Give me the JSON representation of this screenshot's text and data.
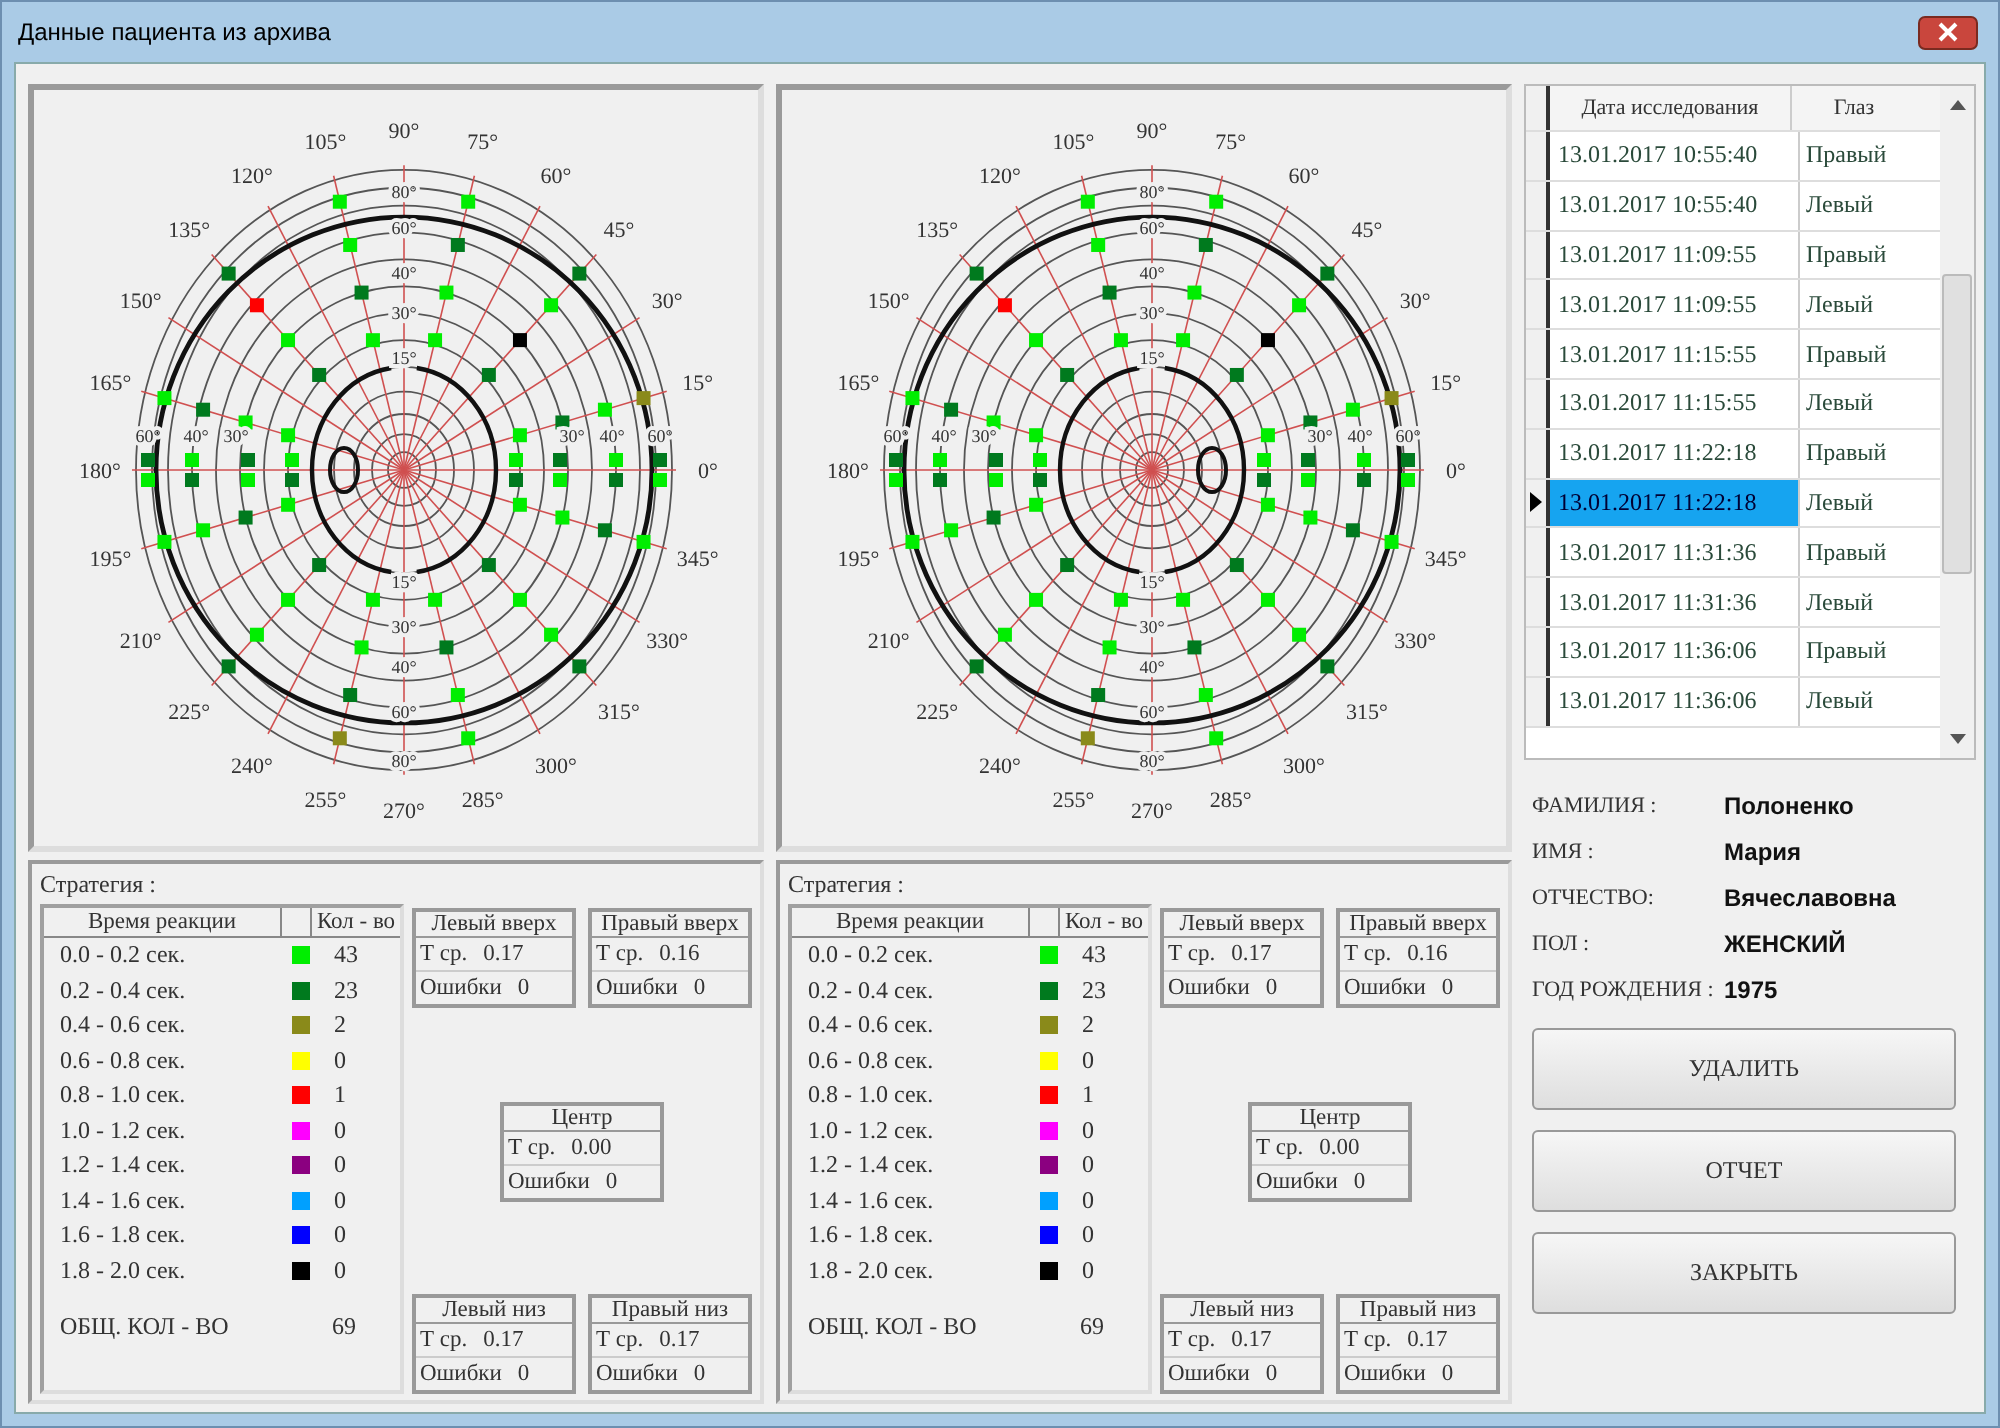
{
  "window": {
    "title": "Данные пациента из архива"
  },
  "fields": [
    {
      "plot": {
        "blind_spot_on_left": true,
        "angle_label_top": "90°",
        "angle_labels_left": [
          "105°",
          "120°",
          "135°",
          "150°",
          "165°",
          "180°",
          "195°",
          "210°",
          "225°",
          "240°",
          "255°"
        ],
        "angle_labels_right": [
          "75°",
          "60°",
          "45°",
          "30°",
          "15°",
          "0°",
          "345°",
          "330°",
          "315°",
          "300°",
          "285°"
        ],
        "angle_label_bottom": "270°",
        "ring_labels_top": [
          "80°",
          "60°",
          "40°",
          "30°",
          "15°"
        ],
        "ring_labels_bottom": [
          "15°",
          "30°",
          "40°",
          "60°",
          "80°"
        ],
        "ring_labels_left": [
          "60°",
          "40°",
          "30°"
        ],
        "ring_labels_right": [
          "30°",
          "40°",
          "60°"
        ]
      },
      "stats": {
        "strategy_label": "Стратегия :",
        "columns": [
          "Время реакции",
          "Кол - во"
        ],
        "rows": [
          {
            "range": "0.0 - 0.2 сек.",
            "color": "#00ee00",
            "count": "43"
          },
          {
            "range": "0.2 - 0.4 сек.",
            "color": "#007a1e",
            "count": "23"
          },
          {
            "range": "0.4 - 0.6 сек.",
            "color": "#8a8a1a",
            "count": "2"
          },
          {
            "range": "0.6 - 0.8 сек.",
            "color": "#ffff00",
            "count": "0"
          },
          {
            "range": "0.8 - 1.0 сек.",
            "color": "#ff0000",
            "count": "1"
          },
          {
            "range": "1.0 - 1.2 сек.",
            "color": "#ff00ff",
            "count": "0"
          },
          {
            "range": "1.2 - 1.4 сек.",
            "color": "#8b0080",
            "count": "0"
          },
          {
            "range": "1.4 - 1.6 сек.",
            "color": "#00a0ff",
            "count": "0"
          },
          {
            "range": "1.6 - 1.8 сек.",
            "color": "#0000ff",
            "count": "0"
          },
          {
            "range": "1.8 - 2.0 сек.",
            "color": "#000000",
            "count": "0"
          }
        ],
        "total_label": "ОБЩ. КОЛ - ВО",
        "total": "69",
        "quadrants": [
          {
            "title": "Левый вверх",
            "t_label": "Т ср.",
            "t_value": "0.17",
            "errors_label": "Ошибки",
            "errors_value": "0"
          },
          {
            "title": "Правый вверх",
            "t_label": "Т ср.",
            "t_value": "0.16",
            "errors_label": "Ошибки",
            "errors_value": "0"
          },
          {
            "title": "Центр",
            "t_label": "Т ср.",
            "t_value": "0.00",
            "errors_label": "Ошибки",
            "errors_value": "0"
          },
          {
            "title": "Левый низ",
            "t_label": "Т ср.",
            "t_value": "0.17",
            "errors_label": "Ошибки",
            "errors_value": "0"
          },
          {
            "title": "Правый низ",
            "t_label": "Т ср.",
            "t_value": "0.17",
            "errors_label": "Ошибки",
            "errors_value": "0"
          }
        ]
      }
    },
    {
      "plot": {
        "blind_spot_on_left": false,
        "angle_label_top": "90°",
        "angle_labels_left": [
          "105°",
          "120°",
          "135°",
          "150°",
          "165°",
          "180°",
          "195°",
          "210°",
          "225°",
          "240°",
          "255°"
        ],
        "angle_labels_right": [
          "75°",
          "60°",
          "45°",
          "30°",
          "15°",
          "0°",
          "345°",
          "330°",
          "315°",
          "300°",
          "285°"
        ],
        "angle_label_bottom": "270°",
        "ring_labels_top": [
          "80°",
          "60°",
          "40°",
          "30°",
          "15°"
        ],
        "ring_labels_bottom": [
          "15°",
          "30°",
          "40°",
          "60°",
          "80°"
        ],
        "ring_labels_left": [
          "60°",
          "40°",
          "30°"
        ],
        "ring_labels_right": [
          "30°",
          "40°",
          "60°"
        ]
      },
      "stats": {
        "strategy_label": "Стратегия :",
        "columns": [
          "Время реакции",
          "Кол - во"
        ],
        "rows": [
          {
            "range": "0.0 - 0.2 сек.",
            "color": "#00ee00",
            "count": "43"
          },
          {
            "range": "0.2 - 0.4 сек.",
            "color": "#007a1e",
            "count": "23"
          },
          {
            "range": "0.4 - 0.6 сек.",
            "color": "#8a8a1a",
            "count": "2"
          },
          {
            "range": "0.6 - 0.8 сек.",
            "color": "#ffff00",
            "count": "0"
          },
          {
            "range": "0.8 - 1.0 сек.",
            "color": "#ff0000",
            "count": "1"
          },
          {
            "range": "1.0 - 1.2 сек.",
            "color": "#ff00ff",
            "count": "0"
          },
          {
            "range": "1.2 - 1.4 сек.",
            "color": "#8b0080",
            "count": "0"
          },
          {
            "range": "1.4 - 1.6 сек.",
            "color": "#00a0ff",
            "count": "0"
          },
          {
            "range": "1.6 - 1.8 сек.",
            "color": "#0000ff",
            "count": "0"
          },
          {
            "range": "1.8 - 2.0 сек.",
            "color": "#000000",
            "count": "0"
          }
        ],
        "total_label": "ОБЩ. КОЛ - ВО",
        "total": "69",
        "quadrants": [
          {
            "title": "Левый вверх",
            "t_label": "Т ср.",
            "t_value": "0.17",
            "errors_label": "Ошибки",
            "errors_value": "0"
          },
          {
            "title": "Правый вверх",
            "t_label": "Т ср.",
            "t_value": "0.16",
            "errors_label": "Ошибки",
            "errors_value": "0"
          },
          {
            "title": "Центр",
            "t_label": "Т ср.",
            "t_value": "0.00",
            "errors_label": "Ошибки",
            "errors_value": "0"
          },
          {
            "title": "Левый низ",
            "t_label": "Т ср.",
            "t_value": "0.17",
            "errors_label": "Ошибки",
            "errors_value": "0"
          },
          {
            "title": "Правый низ",
            "t_label": "Т ср.",
            "t_value": "0.17",
            "errors_label": "Ошибки",
            "errors_value": "0"
          }
        ]
      }
    }
  ],
  "exams": {
    "columns": [
      "Дата исследования",
      "Глаз"
    ],
    "rows": [
      {
        "date": "13.01.2017 10:55:40",
        "eye": "Правый",
        "selected": false
      },
      {
        "date": "13.01.2017 10:55:40",
        "eye": "Левый",
        "selected": false
      },
      {
        "date": "13.01.2017 11:09:55",
        "eye": "Правый",
        "selected": false
      },
      {
        "date": "13.01.2017 11:09:55",
        "eye": "Левый",
        "selected": false
      },
      {
        "date": "13.01.2017 11:15:55",
        "eye": "Правый",
        "selected": false
      },
      {
        "date": "13.01.2017 11:15:55",
        "eye": "Левый",
        "selected": false
      },
      {
        "date": "13.01.2017 11:22:18",
        "eye": "Правый",
        "selected": false
      },
      {
        "date": "13.01.2017 11:22:18",
        "eye": "Левый",
        "selected": true
      },
      {
        "date": "13.01.2017 11:31:36",
        "eye": "Правый",
        "selected": false
      },
      {
        "date": "13.01.2017 11:31:36",
        "eye": "Левый",
        "selected": false
      },
      {
        "date": "13.01.2017 11:36:06",
        "eye": "Правый",
        "selected": false
      },
      {
        "date": "13.01.2017 11:36:06",
        "eye": "Левый",
        "selected": false
      }
    ]
  },
  "patient": [
    {
      "label": "ФАМИЛИЯ :",
      "value": "Полоненко"
    },
    {
      "label": "ИМЯ :",
      "value": "Мария"
    },
    {
      "label": "ОТЧЕСТВО:",
      "value": "Вячеславовна"
    },
    {
      "label": "ПОЛ :",
      "value": "ЖЕНСКИЙ"
    },
    {
      "label": "ГОД РОЖДЕНИЯ :",
      "value": "1975"
    }
  ],
  "buttons": [
    "УДАЛИТЬ",
    "ОТЧЕТ",
    "ЗАКРЫТЬ"
  ]
}
